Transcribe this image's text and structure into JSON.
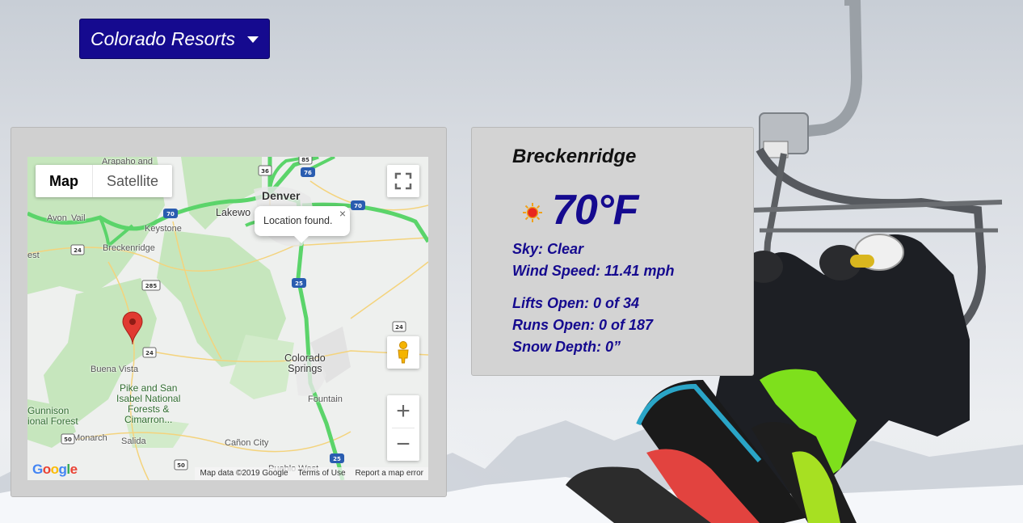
{
  "dropdown": {
    "label": "Colorado Resorts"
  },
  "map": {
    "type_buttons": [
      "Map",
      "Satellite"
    ],
    "infowindow_text": "Location found.",
    "infowindow_close": "×",
    "zoom_in": "+",
    "zoom_out": "−",
    "attribution": {
      "data": "Map data ©2019 Google",
      "terms": "Terms of Use",
      "report": "Report a map error"
    },
    "logo": "Google",
    "labels": {
      "arapaho": "Arapaho and",
      "denver": "Denver",
      "lakewood": "Lakewo",
      "avon": "Avon",
      "vail": "Vail",
      "keystone": "Keystone",
      "breckenridge": "Breckenridge",
      "est": "est",
      "buena_vista": "Buena Vista",
      "pike_san_isabel": "Pike and San\nIsabel National\nForests &\nCimarron...",
      "gunnison": "Gunnison\nional Forest",
      "monarch": "Monarch",
      "salida": "Salida",
      "canon_city": "Cañon City",
      "colorado_springs": "Colorado\nSprings",
      "fountain": "Fountain",
      "pueblo_west": "Pueblo West"
    },
    "shields": {
      "i70_a": "70",
      "i70_b": "70",
      "i76": "76",
      "i25_a": "25",
      "i25_b": "25",
      "us36": "36",
      "us85": "85",
      "us285": "285",
      "us24_a": "24",
      "us24_b": "24",
      "us24_c": "24",
      "us50_a": "50",
      "us50_b": "50"
    }
  },
  "weather": {
    "resort": "Breckenridge",
    "temperature": "70°F",
    "icon": "sun-icon",
    "sky": "Sky: Clear",
    "wind": "Wind Speed: 11.41 mph",
    "lifts": "Lifts Open: 0 of 34",
    "runs": "Runs Open: 0 of 187",
    "snow": "Snow Depth: 0”"
  },
  "colors": {
    "brand": "#150a8f",
    "card": "#d3d3d3",
    "highway": "#5bd46a",
    "pin": "#e03a32"
  }
}
